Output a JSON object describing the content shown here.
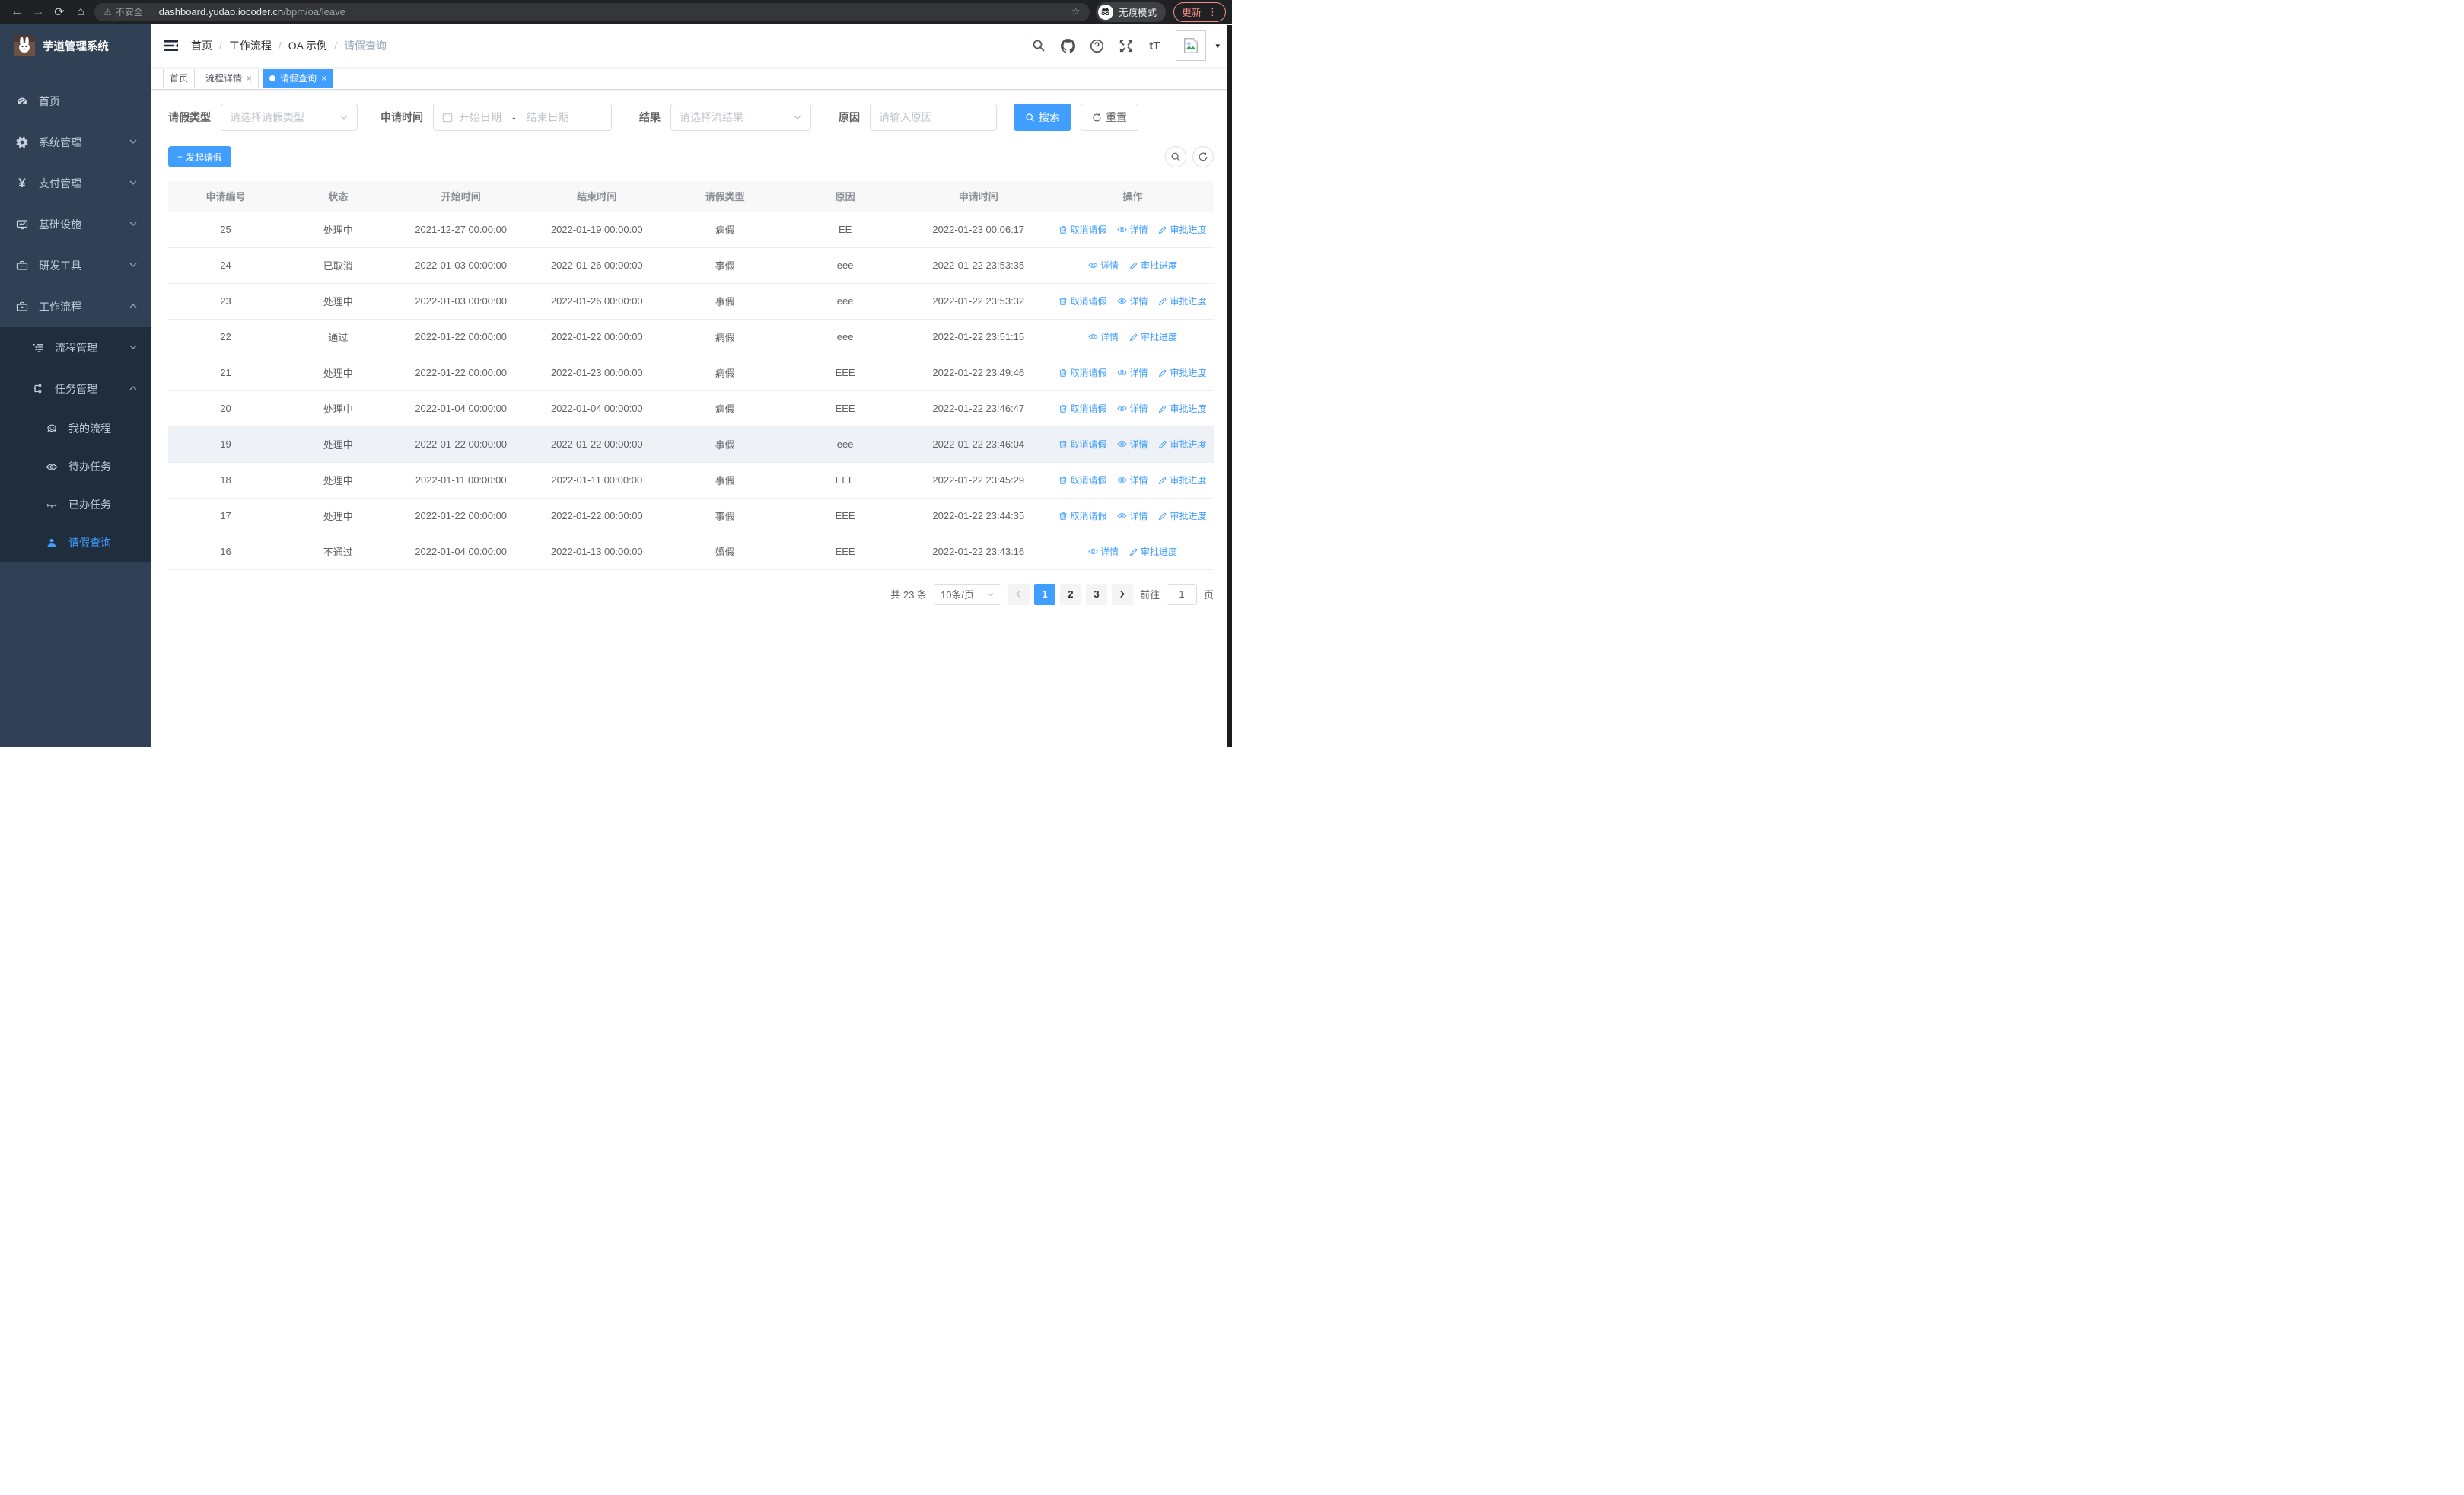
{
  "colors": {
    "primary": "#409eff",
    "sidebar_bg": "#304156",
    "submenu_bg": "#1f2d3d",
    "update_accent": "#f28b82"
  },
  "icons": {
    "back": "←",
    "forward": "→",
    "reload": "⟳",
    "home": "⌂",
    "warning": "⚠",
    "star": "☆",
    "dots_vertical": "⋮",
    "caret_down": "▾",
    "close": "×",
    "dot": "●",
    "font_size": "tT",
    "yen": "¥",
    "plus": "+",
    "breadcrumb_separator": "/"
  },
  "browser": {
    "security_label": "不安全",
    "url_host": "dashboard.yudao.iocoder.cn",
    "url_path": "/bpm/oa/leave",
    "incognito_label": "无痕模式",
    "update_label": "更新"
  },
  "sidebar": {
    "app_title": "芋道管理系统",
    "items": [
      {
        "label": "首页"
      },
      {
        "label": "系统管理"
      },
      {
        "label": "支付管理"
      },
      {
        "label": "基础设施"
      },
      {
        "label": "研发工具"
      },
      {
        "label": "工作流程"
      },
      {
        "label": "流程管理"
      },
      {
        "label": "任务管理"
      },
      {
        "label": "我的流程"
      },
      {
        "label": "待办任务"
      },
      {
        "label": "已办任务"
      },
      {
        "label": "请假查询"
      }
    ]
  },
  "header": {
    "breadcrumb": [
      "首页",
      "工作流程",
      "OA 示例",
      "请假查询"
    ]
  },
  "tabs": [
    {
      "label": "首页"
    },
    {
      "label": "流程详情"
    },
    {
      "label": "请假查询"
    }
  ],
  "filters": {
    "leave_type_label": "请假类型",
    "leave_type_placeholder": "请选择请假类型",
    "apply_time_label": "申请时间",
    "start_date_placeholder": "开始日期",
    "date_separator": "-",
    "end_date_placeholder": "结束日期",
    "result_label": "结果",
    "result_placeholder": "请选择流结果",
    "reason_label": "原因",
    "reason_placeholder": "请输入原因",
    "search_label": "搜索",
    "reset_label": "重置"
  },
  "toolbar": {
    "create_label": "发起请假"
  },
  "table": {
    "columns": [
      "申请编号",
      "状态",
      "开始时间",
      "结束时间",
      "请假类型",
      "原因",
      "申请时间",
      "操作"
    ],
    "action_labels": {
      "cancel": "取消请假",
      "detail": "详情",
      "progress": "审批进度"
    },
    "rows": [
      {
        "id": "25",
        "status": "处理中",
        "start": "2021-12-27 00:00:00",
        "end": "2022-01-19 00:00:00",
        "type": "病假",
        "reason": "EE",
        "apply": "2022-01-23 00:06:17",
        "actions": [
          "cancel",
          "detail",
          "progress"
        ],
        "highlight": false
      },
      {
        "id": "24",
        "status": "已取消",
        "start": "2022-01-03 00:00:00",
        "end": "2022-01-26 00:00:00",
        "type": "事假",
        "reason": "eee",
        "apply": "2022-01-22 23:53:35",
        "actions": [
          "detail",
          "progress"
        ],
        "highlight": false
      },
      {
        "id": "23",
        "status": "处理中",
        "start": "2022-01-03 00:00:00",
        "end": "2022-01-26 00:00:00",
        "type": "事假",
        "reason": "eee",
        "apply": "2022-01-22 23:53:32",
        "actions": [
          "cancel",
          "detail",
          "progress"
        ],
        "highlight": false
      },
      {
        "id": "22",
        "status": "通过",
        "start": "2022-01-22 00:00:00",
        "end": "2022-01-22 00:00:00",
        "type": "病假",
        "reason": "eee",
        "apply": "2022-01-22 23:51:15",
        "actions": [
          "detail",
          "progress"
        ],
        "highlight": false
      },
      {
        "id": "21",
        "status": "处理中",
        "start": "2022-01-22 00:00:00",
        "end": "2022-01-23 00:00:00",
        "type": "病假",
        "reason": "EEE",
        "apply": "2022-01-22 23:49:46",
        "actions": [
          "cancel",
          "detail",
          "progress"
        ],
        "highlight": false
      },
      {
        "id": "20",
        "status": "处理中",
        "start": "2022-01-04 00:00:00",
        "end": "2022-01-04 00:00:00",
        "type": "病假",
        "reason": "EEE",
        "apply": "2022-01-22 23:46:47",
        "actions": [
          "cancel",
          "detail",
          "progress"
        ],
        "highlight": false
      },
      {
        "id": "19",
        "status": "处理中",
        "start": "2022-01-22 00:00:00",
        "end": "2022-01-22 00:00:00",
        "type": "事假",
        "reason": "eee",
        "apply": "2022-01-22 23:46:04",
        "actions": [
          "cancel",
          "detail",
          "progress"
        ],
        "highlight": true
      },
      {
        "id": "18",
        "status": "处理中",
        "start": "2022-01-11 00:00:00",
        "end": "2022-01-11 00:00:00",
        "type": "事假",
        "reason": "EEE",
        "apply": "2022-01-22 23:45:29",
        "actions": [
          "cancel",
          "detail",
          "progress"
        ],
        "highlight": false
      },
      {
        "id": "17",
        "status": "处理中",
        "start": "2022-01-22 00:00:00",
        "end": "2022-01-22 00:00:00",
        "type": "事假",
        "reason": "EEE",
        "apply": "2022-01-22 23:44:35",
        "actions": [
          "cancel",
          "detail",
          "progress"
        ],
        "highlight": false
      },
      {
        "id": "16",
        "status": "不通过",
        "start": "2022-01-04 00:00:00",
        "end": "2022-01-13 00:00:00",
        "type": "婚假",
        "reason": "EEE",
        "apply": "2022-01-22 23:43:16",
        "actions": [
          "detail",
          "progress"
        ],
        "highlight": false
      }
    ]
  },
  "pagination": {
    "total_label": "共 23 条",
    "page_size": "10条/页",
    "pages": [
      "1",
      "2",
      "3"
    ],
    "active_page": "1",
    "goto_label": "前往",
    "goto_value": "1",
    "page_label": "页"
  }
}
